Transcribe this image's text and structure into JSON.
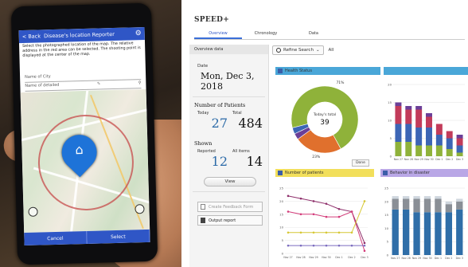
{
  "phone": {
    "header_back": "< Back",
    "header_title": "Disease's location Reporter",
    "description": "Select the photographed location of the map. The relative address in the red area can be selected. The shooting point is displayed at the center of the map.",
    "field_city": "Name of City",
    "field_detail": "Name of detailed",
    "button_cancel": "Cancel",
    "button_select": "Select"
  },
  "dashboard": {
    "brand": "SPEED+",
    "tabs": [
      "Overview",
      "Chronology",
      "Data"
    ],
    "overview_title": "Overview data",
    "refine_label": "Refine Search",
    "all_label": "All",
    "date_label": "Date",
    "date_value": "Mon, Dec 3, 2018",
    "patients_section": "Number of Patients",
    "today_label": "Today",
    "total_label": "Total",
    "patients_today": "27",
    "patients_total": "484",
    "shown_section": "Shown",
    "reported_label": "Reported",
    "allitems_label": "All items",
    "shown_reported": "12",
    "shown_all": "14",
    "view_button": "View",
    "feedback_button": "Create Feedback Form",
    "output_button": "Output report",
    "health_card_title": "Health Status",
    "done_button": "Done",
    "patients_card_title": "Number of patients",
    "disorder_card_title": "Behavior in disaster"
  },
  "colors": {
    "accent": "#2f56c6",
    "donut_green": "#8fb23a",
    "donut_orange": "#e0702d",
    "donut_purple": "#6b3f98",
    "donut_blue": "#3c65b5"
  },
  "chart_data": [
    {
      "type": "pie",
      "title": "Health Status",
      "center_label": "Today's total",
      "center_value": "39",
      "slices": [
        {
          "label": "71%",
          "value": 71,
          "color": "#8fb23a"
        },
        {
          "label": "23%",
          "value": 23,
          "color": "#e0702d"
        },
        {
          "label": "",
          "value": 3,
          "color": "#6b3f98"
        },
        {
          "label": "",
          "value": 3,
          "color": "#3c65b5"
        }
      ]
    },
    {
      "type": "bar",
      "stacked": true,
      "categories": [
        "Nov 27",
        "Nov 28",
        "Nov 29",
        "Nov 30",
        "Dec 1",
        "Dec 2",
        "Dec 3"
      ],
      "ylim": [
        0,
        20
      ],
      "yticks": [
        "0",
        "5",
        "10",
        "15",
        "20"
      ],
      "series": [
        {
          "values": [
            4,
            4,
            3,
            3,
            3,
            2,
            1
          ],
          "color": "#8fb23a"
        },
        {
          "values": [
            5,
            5,
            5,
            5,
            3,
            3,
            2
          ],
          "color": "#3c65b5"
        },
        {
          "values": [
            5,
            4,
            5,
            3,
            3,
            2,
            2
          ],
          "color": "#c23b5a"
        },
        {
          "values": [
            1,
            1,
            1,
            1,
            0,
            0,
            1
          ],
          "color": "#6b3f98"
        }
      ]
    },
    {
      "type": "line",
      "title": "Number of patients",
      "x": [
        "Nov 27",
        "Nov 28",
        "Nov 29",
        "Nov 30",
        "Dec 1",
        "Dec 2",
        "Dec 3"
      ],
      "ylim": [
        0,
        25
      ],
      "yticks": [
        "0",
        "5",
        "10",
        "15",
        "20",
        "25"
      ],
      "series": [
        {
          "values": [
            22,
            21,
            20,
            19,
            17,
            16,
            4
          ],
          "color": "#8e2f6b"
        },
        {
          "values": [
            16,
            15,
            15,
            14,
            14,
            16,
            1
          ],
          "color": "#d33c7a"
        },
        {
          "values": [
            8,
            8,
            8,
            8,
            8,
            8,
            20
          ],
          "color": "#d6c733"
        },
        {
          "values": [
            3,
            3,
            3,
            3,
            3,
            3,
            3
          ],
          "color": "#7b6cbf"
        }
      ]
    },
    {
      "type": "bar",
      "stacked": true,
      "title": "Behavior in disaster",
      "categories": [
        "Nov 27",
        "Nov 28",
        "Nov 29",
        "Nov 30",
        "Dec 1",
        "Dec 2",
        "Dec 3"
      ],
      "ylim": [
        0,
        25
      ],
      "yticks": [
        "0",
        "5",
        "10",
        "15",
        "20",
        "25"
      ],
      "series": [
        {
          "values": [
            17,
            17,
            16,
            16,
            16,
            16,
            17
          ],
          "color": "#2f6ea8"
        },
        {
          "values": [
            4,
            4,
            5,
            5,
            5,
            3,
            3
          ],
          "color": "#8a8f96"
        },
        {
          "values": [
            1,
            1,
            1,
            1,
            1,
            1,
            1
          ],
          "color": "#cfd6de"
        }
      ]
    }
  ]
}
